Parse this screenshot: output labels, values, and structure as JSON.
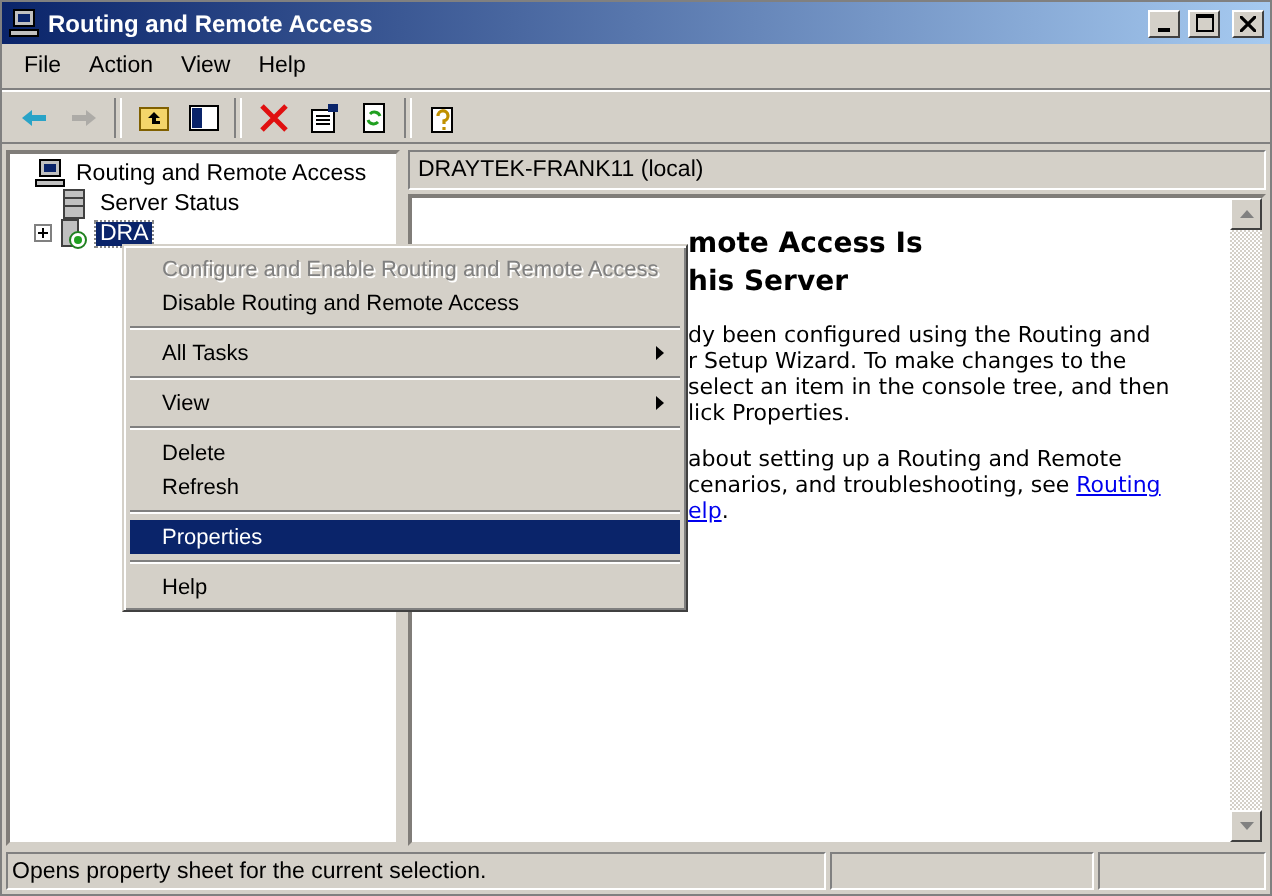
{
  "window": {
    "title": "Routing and Remote Access"
  },
  "menu_bar": [
    "File",
    "Action",
    "View",
    "Help"
  ],
  "toolbar": [
    {
      "kind": "back",
      "disabled": false
    },
    {
      "kind": "forward",
      "disabled": true
    },
    {
      "kind": "up",
      "disabled": false
    },
    {
      "kind": "tree",
      "disabled": false
    },
    {
      "kind": "delete",
      "disabled": false
    },
    {
      "kind": "properties",
      "disabled": false
    },
    {
      "kind": "refresh",
      "disabled": false
    },
    {
      "kind": "help",
      "disabled": false
    }
  ],
  "tree": [
    {
      "label": "Routing and Remote Access",
      "kind": "root",
      "selected": false,
      "children": [
        {
          "label": "Server Status",
          "kind": "status",
          "selected": false
        },
        {
          "label": "DRA",
          "kind": "server",
          "selected": true,
          "expanded": false
        }
      ]
    }
  ],
  "detail": {
    "header": "DRAYTEK-FRANK11 (local)",
    "heading": [
      "mote Access Is",
      "his Server"
    ],
    "paragraphs": [
      {
        "lines": [
          {
            "text": "dy been configured using the Routing and"
          },
          {
            "text": "r Setup Wizard. To make changes to the"
          },
          {
            "text": "select an item in the console tree, and then"
          },
          {
            "text": "lick Properties."
          }
        ]
      },
      {
        "lines": [
          {
            "text": "about setting up a Routing and Remote"
          },
          {
            "text": "cenarios, and troubleshooting, see ",
            "link": "Routing"
          },
          {
            "link": "elp",
            "after": "."
          }
        ]
      }
    ]
  },
  "context_menu": [
    {
      "kind": "item",
      "label": "Configure and Enable Routing and Remote Access",
      "disabled": true,
      "selected": false
    },
    {
      "kind": "item",
      "label": "Disable Routing and Remote Access",
      "disabled": false,
      "selected": false
    },
    {
      "kind": "separator"
    },
    {
      "kind": "submenu",
      "label": "All Tasks",
      "disabled": false,
      "selected": false
    },
    {
      "kind": "separator"
    },
    {
      "kind": "submenu",
      "label": "View",
      "disabled": false,
      "selected": false
    },
    {
      "kind": "separator"
    },
    {
      "kind": "item",
      "label": "Delete",
      "disabled": false,
      "selected": false
    },
    {
      "kind": "item",
      "label": "Refresh",
      "disabled": false,
      "selected": false
    },
    {
      "kind": "separator"
    },
    {
      "kind": "item",
      "label": "Properties",
      "disabled": false,
      "selected": true
    },
    {
      "kind": "separator"
    },
    {
      "kind": "item",
      "label": "Help",
      "disabled": false,
      "selected": false
    }
  ],
  "status_bar": {
    "text": "Opens property sheet for the current selection."
  }
}
